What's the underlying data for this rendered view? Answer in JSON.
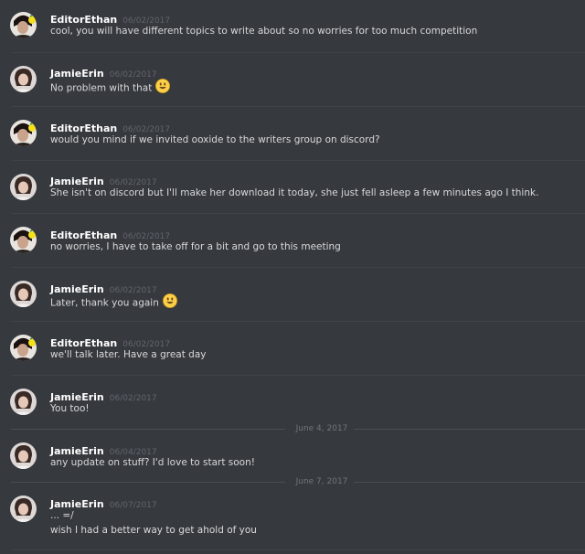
{
  "messages": [
    {
      "author": "EditorEthan",
      "time": "06/02/2017",
      "lines": [
        "cool, you will have different topics to write about so no worries for too much competition"
      ],
      "emoji": false
    },
    {
      "author": "JamieErin",
      "time": "06/02/2017",
      "lines": [
        "No problem with that"
      ],
      "emoji": true
    },
    {
      "author": "EditorEthan",
      "time": "06/02/2017",
      "lines": [
        "would you mind if we invited ooxide to the writers group on discord?"
      ],
      "emoji": false
    },
    {
      "author": "JamieErin",
      "time": "06/02/2017",
      "lines": [
        "She isn't on discord but I'll make her download it today, she just fell asleep a few minutes ago I think."
      ],
      "emoji": false
    },
    {
      "author": "EditorEthan",
      "time": "06/02/2017",
      "lines": [
        "no worries, I have to take off for a bit and go to this meeting"
      ],
      "emoji": false
    },
    {
      "author": "JamieErin",
      "time": "06/02/2017",
      "lines": [
        "Later, thank you again"
      ],
      "emoji": true
    },
    {
      "author": "EditorEthan",
      "time": "06/02/2017",
      "lines": [
        "we'll talk later. Have a great day"
      ],
      "emoji": false
    },
    {
      "author": "JamieErin",
      "time": "06/02/2017",
      "lines": [
        "You too!"
      ],
      "emoji": false
    },
    {
      "author": "JamieErin",
      "time": "06/04/2017",
      "lines": [
        "any update on stuff? I'd love to start soon!"
      ],
      "emoji": false
    },
    {
      "author": "JamieErin",
      "time": "06/07/2017",
      "lines": [
        "... =/",
        "wish I had a better way to get ahold of you"
      ],
      "emoji": false
    }
  ],
  "date_separators": [
    "June 4, 2017",
    "June 7, 2017"
  ],
  "colors": {
    "background": "#36393e",
    "author": "#ffffff",
    "timestamp": "#62656c",
    "text": "#d8d9da",
    "emoji": "#fdd04a"
  },
  "icons": {
    "avatar_ethan": "avatar-ethan",
    "avatar_jamie": "avatar-jamie",
    "emoji": "smiley-emoji-icon"
  }
}
